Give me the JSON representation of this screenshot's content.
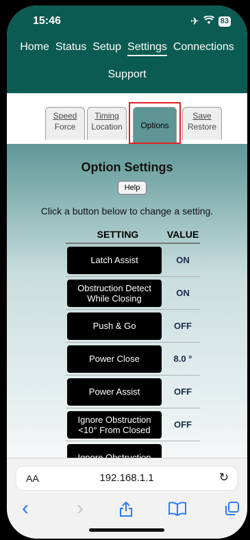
{
  "status": {
    "time": "15:46",
    "airplane": "✈",
    "wifi": "ᯤ",
    "battery": "83"
  },
  "nav": {
    "row1": [
      {
        "label": "Home",
        "active": false
      },
      {
        "label": "Status",
        "active": false
      },
      {
        "label": "Setup",
        "active": false
      },
      {
        "label": "Settings",
        "active": true
      },
      {
        "label": "Connections",
        "active": false
      }
    ],
    "row2": [
      {
        "label": "Support",
        "active": false
      }
    ]
  },
  "tabs": [
    {
      "line1": "Speed",
      "line2": "Force",
      "active": false
    },
    {
      "line1": "Timing",
      "line2": "Location",
      "active": false
    },
    {
      "label": "Options",
      "active": true
    },
    {
      "line1": "Save",
      "line2": "Restore",
      "active": false
    }
  ],
  "panel": {
    "title": "Option Settings",
    "help_label": "Help",
    "intro": "Click a button below to change a setting."
  },
  "table": {
    "header_setting": "SETTING",
    "header_value": "VALUE",
    "rows": [
      {
        "setting": "Latch Assist",
        "value": "ON"
      },
      {
        "setting": "Obstruction Detect While Closing",
        "value": "ON"
      },
      {
        "setting": "Push & Go",
        "value": "OFF"
      },
      {
        "setting": "Power Close",
        "value": "8.0 °"
      },
      {
        "setting": "Power Assist",
        "value": "OFF"
      },
      {
        "setting": "Ignore Obstruction <10° From Closed",
        "value": "OFF"
      },
      {
        "setting": "Ignore Obstruction",
        "value": ""
      }
    ]
  },
  "browser": {
    "aa_label": "AA",
    "url": "192.168.1.1",
    "reload_icon": "↻",
    "back_icon": "‹",
    "forward_icon": "›",
    "share_icon": "⇪",
    "bookmarks_icon": "📖",
    "tabs_icon": "⧉"
  },
  "colors": {
    "brand": "#0b5b52",
    "panel_top": "#5f9797",
    "highlight": "#e02020",
    "link": "#2a7cf5"
  }
}
